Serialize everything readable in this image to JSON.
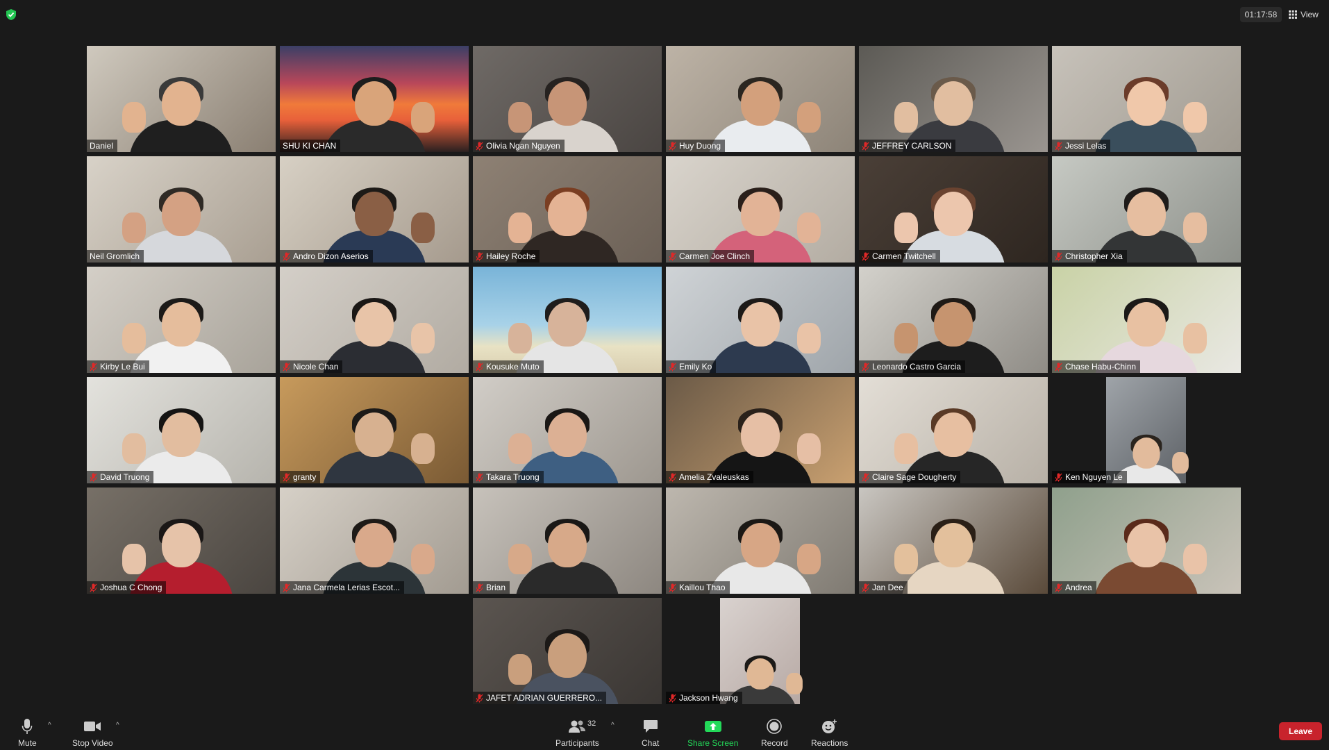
{
  "meeting": {
    "timer": "01:17:58",
    "view_label": "View"
  },
  "colors": {
    "active_speaker_border": "#d7e94e",
    "leave_red": "#c8232c",
    "share_green": "#23d959",
    "mic_off_red": "#e02828"
  },
  "participants": [
    {
      "name": "Daniel",
      "muted": false,
      "active": false
    },
    {
      "name": "SHU KI CHAN",
      "muted": false,
      "active": true
    },
    {
      "name": "Olivia Ngan Nguyen",
      "muted": true,
      "active": false
    },
    {
      "name": "Huy Duong",
      "muted": true,
      "active": false
    },
    {
      "name": "JEFFREY CARLSON",
      "muted": true,
      "active": false
    },
    {
      "name": "Jessi Lelas",
      "muted": true,
      "active": false
    },
    {
      "name": "Neil Gromlich",
      "muted": false,
      "active": false
    },
    {
      "name": "Andro Dizon Aserios",
      "muted": true,
      "active": false
    },
    {
      "name": "Hailey Roche",
      "muted": true,
      "active": false
    },
    {
      "name": "Carmen Joe Clinch",
      "muted": true,
      "active": false
    },
    {
      "name": "Carmen Twitchell",
      "muted": true,
      "active": false
    },
    {
      "name": "Christopher Xia",
      "muted": true,
      "active": false
    },
    {
      "name": "Kirby Le Bui",
      "muted": true,
      "active": false
    },
    {
      "name": "Nicole Chan",
      "muted": true,
      "active": false
    },
    {
      "name": "Kousuke Muto",
      "muted": true,
      "active": false
    },
    {
      "name": "Emily Ko",
      "muted": true,
      "active": false
    },
    {
      "name": "Leonardo Castro Garcia",
      "muted": true,
      "active": false
    },
    {
      "name": "Chase Habu-Chinn",
      "muted": true,
      "active": false
    },
    {
      "name": "David Truong",
      "muted": true,
      "active": false
    },
    {
      "name": "granty",
      "muted": true,
      "active": false
    },
    {
      "name": "Takara Truong",
      "muted": true,
      "active": false
    },
    {
      "name": "Amelia Zvaleuskas",
      "muted": true,
      "active": false
    },
    {
      "name": "Claire Sage Dougherty",
      "muted": true,
      "active": false
    },
    {
      "name": "Ken Nguyen Le",
      "muted": true,
      "active": false
    },
    {
      "name": "Joshua C Chong",
      "muted": true,
      "active": false
    },
    {
      "name": "Jana Carmela Lerias Escot...",
      "muted": true,
      "active": false
    },
    {
      "name": "Brian",
      "muted": true,
      "active": false
    },
    {
      "name": "Kaillou Thao",
      "muted": true,
      "active": false
    },
    {
      "name": "Jan Dee",
      "muted": true,
      "active": false
    },
    {
      "name": "Andrea",
      "muted": true,
      "active": false
    },
    {
      "name": "JAFET ADRIAN GUERRERO...",
      "muted": true,
      "active": false
    },
    {
      "name": "Jackson Hwang",
      "muted": true,
      "active": false
    }
  ],
  "toolbar": {
    "mute_label": "Mute",
    "stop_video_label": "Stop Video",
    "participants_label": "Participants",
    "participants_count": "32",
    "chat_label": "Chat",
    "share_screen_label": "Share Screen",
    "record_label": "Record",
    "reactions_label": "Reactions",
    "leave_label": "Leave"
  }
}
